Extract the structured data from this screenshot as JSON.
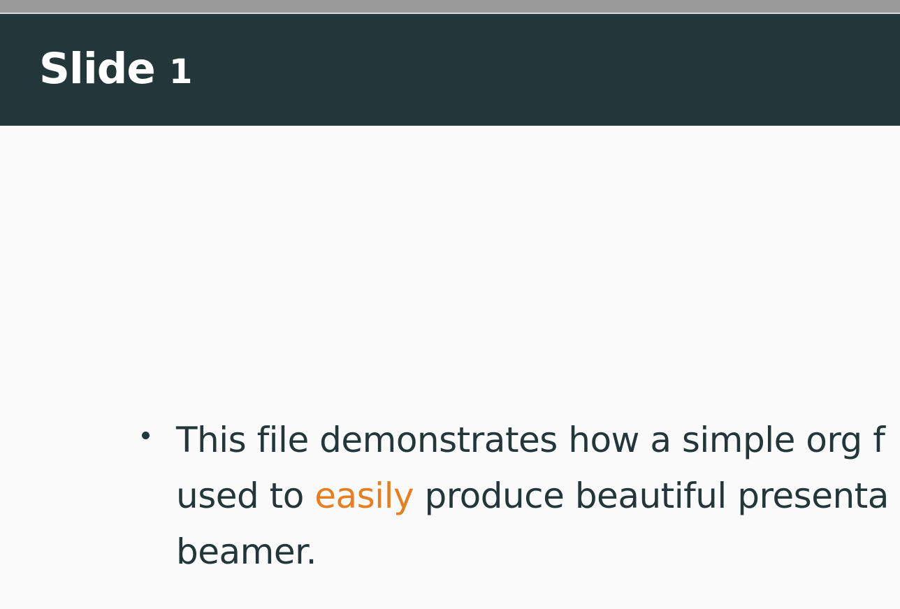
{
  "slide": {
    "title_word": "Slide",
    "title_number": "1"
  },
  "content": {
    "bullets": [
      {
        "line1": "This file demonstrates how a simple org f",
        "line2_pre": "used to ",
        "line2_accent": "easily",
        "line2_post": " produce beautiful presenta",
        "line3": "beamer."
      }
    ]
  },
  "colors": {
    "header_bg": "#23373b",
    "accent": "#e67e22",
    "body_bg": "#fafafa",
    "text": "#23373b"
  }
}
